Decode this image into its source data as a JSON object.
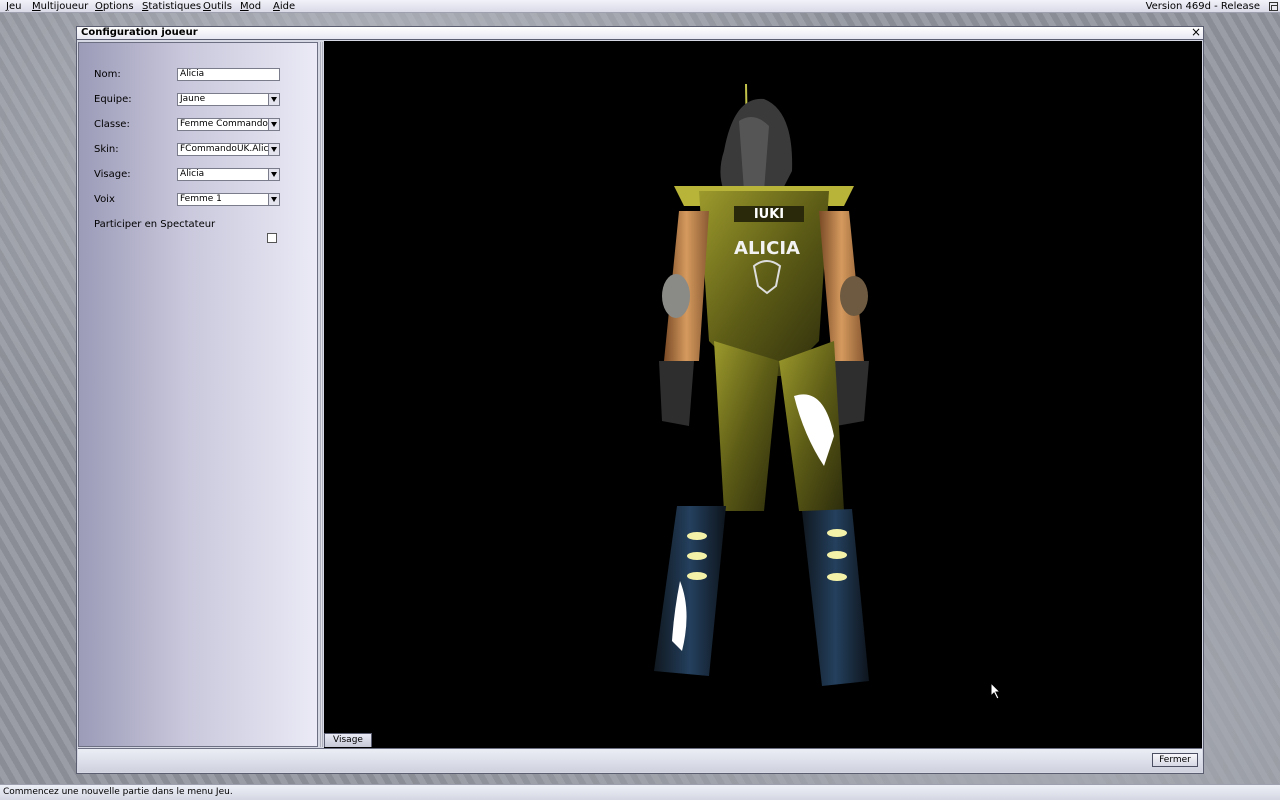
{
  "menubar": {
    "items": [
      {
        "label": "Jeu"
      },
      {
        "label": "Multijoueur"
      },
      {
        "label": "Options"
      },
      {
        "label": "Statistiques"
      },
      {
        "label": "Outils"
      },
      {
        "label": "Mod"
      },
      {
        "label": "Aide"
      }
    ],
    "version": "Version 469d - Release",
    "restore_icon": "restore-window-icon"
  },
  "window": {
    "title": "Configuration joueur",
    "close_glyph": "×",
    "close_icon": "close-icon"
  },
  "form": {
    "name": {
      "label": "Nom:",
      "value": "Alicia"
    },
    "team": {
      "label": "Equipe:",
      "value": "Jaune"
    },
    "class": {
      "label": "Classe:",
      "value": "Femme Commando"
    },
    "skin": {
      "label": "Skin:",
      "value": "FCommandoUK.Alicia"
    },
    "face": {
      "label": "Visage:",
      "value": "Alicia"
    },
    "voice": {
      "label": "Voix",
      "value": "Femme 1"
    },
    "spectator": {
      "label": "Participer en Spectateur",
      "checked": false
    }
  },
  "preview": {
    "model_back_text": "IUKI",
    "model_name_text": "ALICIA",
    "tab_label": "Visage",
    "colors": {
      "armor": "#6b6a1a",
      "armor_light": "#b3b33a",
      "skin": "#c98a4e",
      "boots": "#1e2f44"
    }
  },
  "footer": {
    "close_label": "Fermer"
  },
  "statusbar": {
    "text": "Commencez une nouvelle partie dans le menu Jeu."
  }
}
